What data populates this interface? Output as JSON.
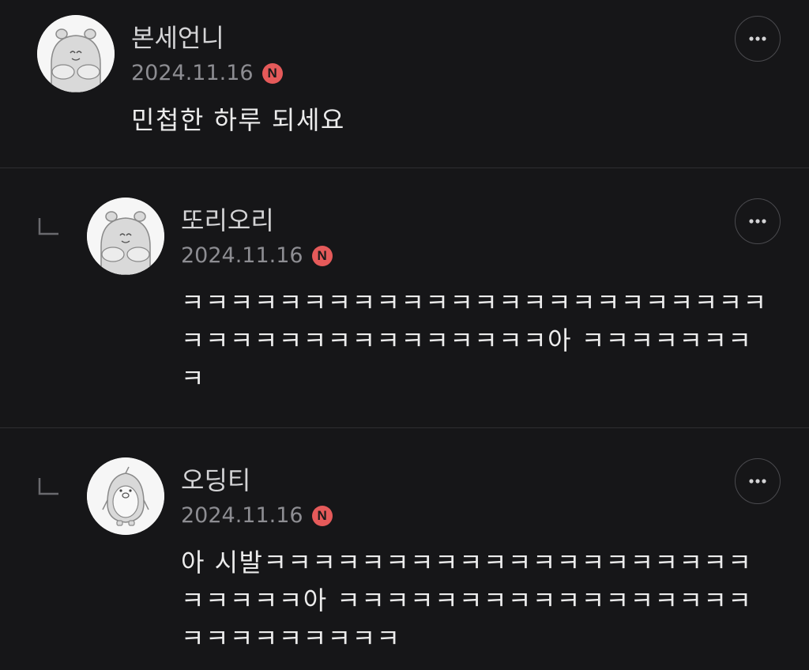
{
  "comments": [
    {
      "author": "본세언니",
      "date": "2024.11.16",
      "badge": "N",
      "text": "민첩한 하루 되세요",
      "avatar_icon": "hamster-avatar-icon"
    },
    {
      "author": "또리오리",
      "date": "2024.11.16",
      "badge": "N",
      "text": "ㅋㅋㅋㅋㅋㅋㅋㅋㅋㅋㅋㅋㅋㅋㅋㅋㅋㅋㅋㅋㅋㅋㅋㅋㅋㅋㅋㅋㅋㅋㅋㅋㅋㅋㅋㅋㅋㅋㅋ아 ㅋㅋㅋㅋㅋㅋㅋㅋ",
      "avatar_icon": "hamster-avatar-icon",
      "is_reply": true
    },
    {
      "author": "오딩티",
      "date": "2024.11.16",
      "badge": "N",
      "text": "아 시발ㅋㅋㅋㅋㅋㅋㅋㅋㅋㅋㅋㅋㅋㅋㅋㅋㅋㅋㅋㅋㅋㅋㅋㅋㅋ아 ㅋㅋㅋㅋㅋㅋㅋㅋㅋㅋㅋㅋㅋㅋㅋㅋㅋㅋㅋㅋㅋㅋㅋㅋㅋㅋ",
      "avatar_icon": "penguin-avatar-icon",
      "is_reply": true
    }
  ],
  "colors": {
    "background": "#161618",
    "badge": "#e55a5a",
    "text": "#ececec",
    "date": "#8d8d92"
  }
}
